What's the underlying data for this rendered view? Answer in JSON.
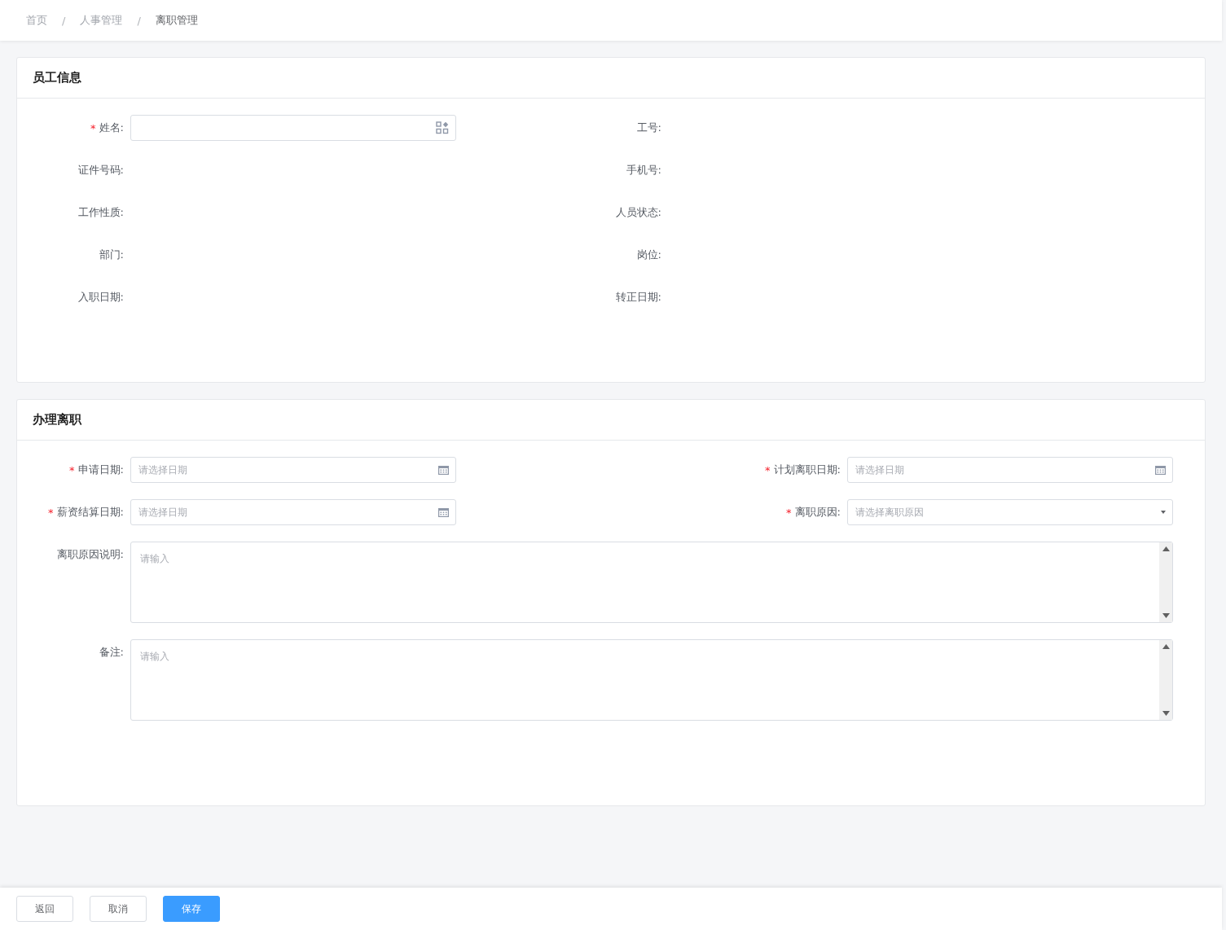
{
  "breadcrumb": [
    {
      "label": "首页",
      "current": false
    },
    {
      "label": "人事管理",
      "current": false
    },
    {
      "label": "离职管理",
      "current": true
    }
  ],
  "breadcrumb_separator": "/",
  "required_mark": "*",
  "sections": [
    {
      "title": "员工信息",
      "fields": [
        {
          "kind": "picker",
          "label": "姓名:",
          "required": true
        },
        {
          "kind": "static",
          "label": "工号:",
          "required": false
        },
        {
          "kind": "static",
          "label": "证件号码:",
          "required": false
        },
        {
          "kind": "static",
          "label": "手机号:",
          "required": false
        },
        {
          "kind": "static",
          "label": "工作性质:",
          "required": false
        },
        {
          "kind": "static",
          "label": "人员状态:",
          "required": false
        },
        {
          "kind": "static",
          "label": "部门:",
          "required": false
        },
        {
          "kind": "static",
          "label": "岗位:",
          "required": false
        },
        {
          "kind": "static",
          "label": "入职日期:",
          "required": false
        },
        {
          "kind": "static",
          "label": "转正日期:",
          "required": false
        }
      ]
    },
    {
      "title": "办理离职",
      "fields": [
        {
          "kind": "date",
          "label": "申请日期:",
          "required": true,
          "placeholder": "请选择日期"
        },
        {
          "kind": "date",
          "label": "计划离职日期:",
          "required": true,
          "placeholder": "请选择日期"
        },
        {
          "kind": "date",
          "label": "薪资结算日期:",
          "required": true,
          "placeholder": "请选择日期"
        },
        {
          "kind": "select",
          "label": "离职原因:",
          "required": true,
          "placeholder": "请选择离职原因"
        },
        {
          "kind": "textarea",
          "label": "离职原因说明:",
          "required": false,
          "placeholder": "请输入"
        },
        {
          "kind": "textarea",
          "label": "备注:",
          "required": false,
          "placeholder": "请输入"
        }
      ]
    }
  ],
  "buttons": [
    {
      "label": "返回",
      "primary": false
    },
    {
      "label": "取消",
      "primary": false
    },
    {
      "label": "保存",
      "primary": true
    }
  ]
}
